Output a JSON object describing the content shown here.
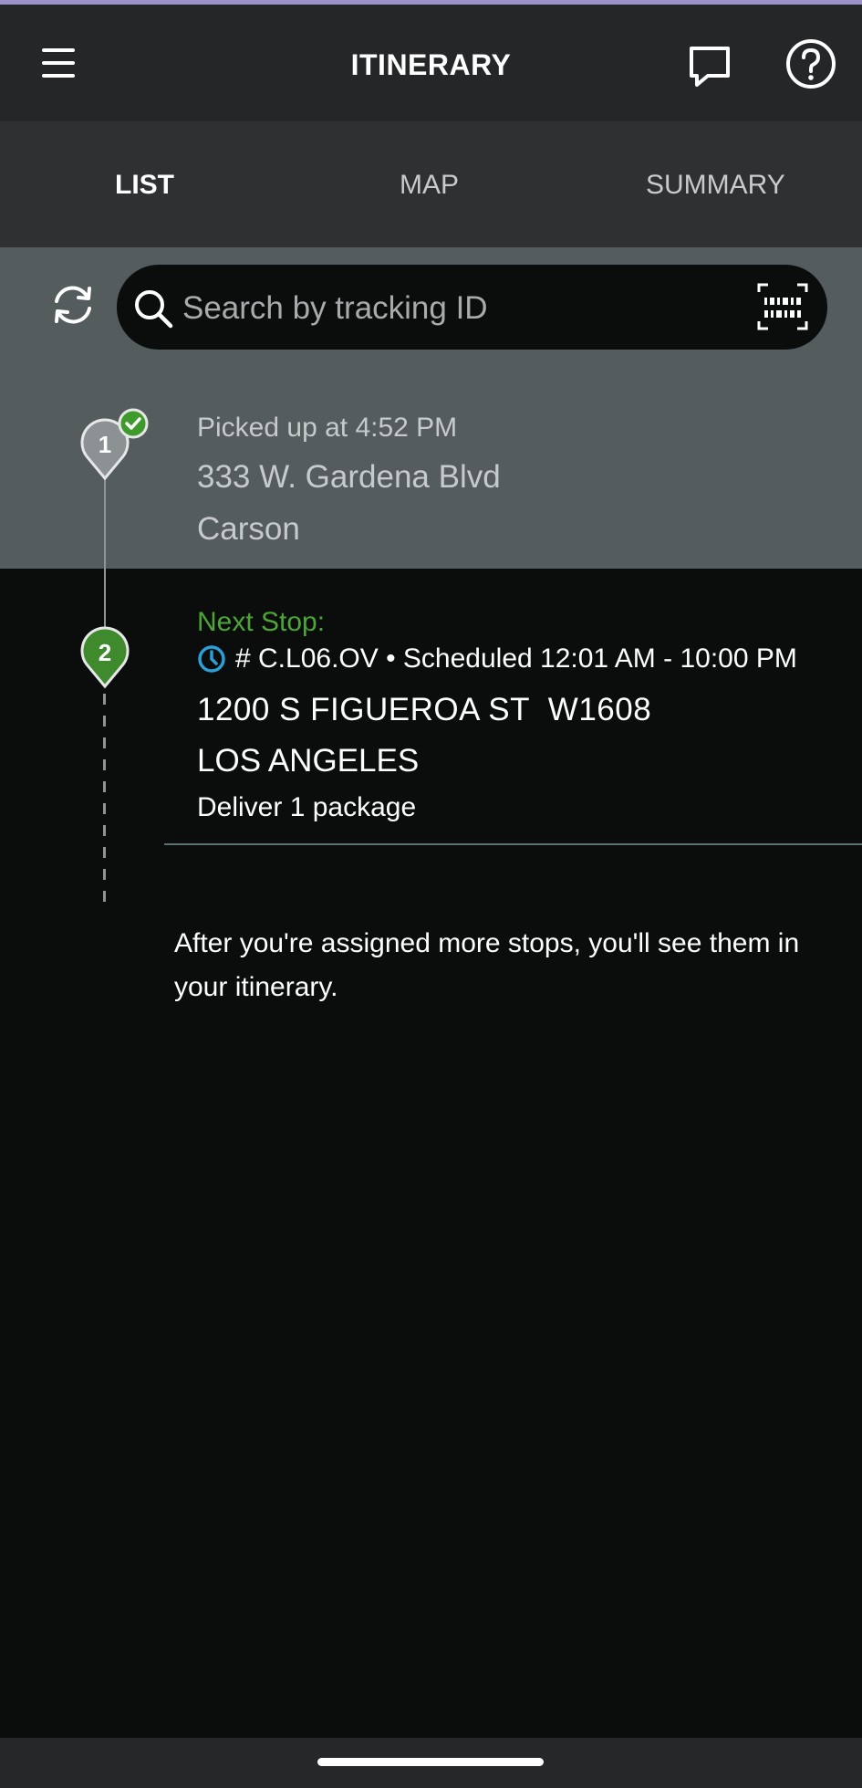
{
  "header": {
    "title": "ITINERARY",
    "accent_color": "#9d92c8"
  },
  "tabs": [
    {
      "label": "LIST",
      "active": true
    },
    {
      "label": "MAP",
      "active": false
    },
    {
      "label": "SUMMARY",
      "active": false
    }
  ],
  "search": {
    "placeholder": "Search by tracking ID"
  },
  "stops": {
    "completed": {
      "number": "1",
      "status": "Picked up at 4:52 PM",
      "address": "333 W. Gardena Blvd",
      "city": "Carson"
    },
    "next": {
      "number": "2",
      "label": "Next Stop:",
      "schedule": "# C.L06.OV • Scheduled 12:01 AM - 10:00 PM",
      "address": "1200 S FIGUEROA ST  W1608",
      "city": "LOS ANGELES",
      "packages": "Deliver 1 package"
    }
  },
  "empty_message": "After you're assigned more stops, you'll see them in your itinerary.",
  "colors": {
    "success_green": "#4ca535",
    "clock_blue": "#2a9fd8"
  }
}
